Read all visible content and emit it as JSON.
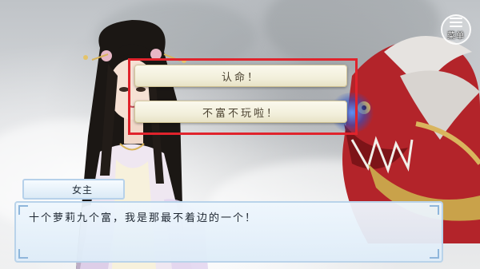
{
  "menu": {
    "label": "菜单",
    "icon": "menu-icon"
  },
  "choices": [
    {
      "label": "认命！"
    },
    {
      "label": "不富不玩啦！"
    }
  ],
  "dialogue": {
    "speaker": "女主",
    "text": "十个萝莉九个富，我是那最不着边的一个！"
  },
  "colors": {
    "highlight": "#e0232c",
    "choice_bg": "#f2efdb",
    "dialog_bg": "#e4eff9",
    "dialog_border": "#b9d3ea"
  }
}
